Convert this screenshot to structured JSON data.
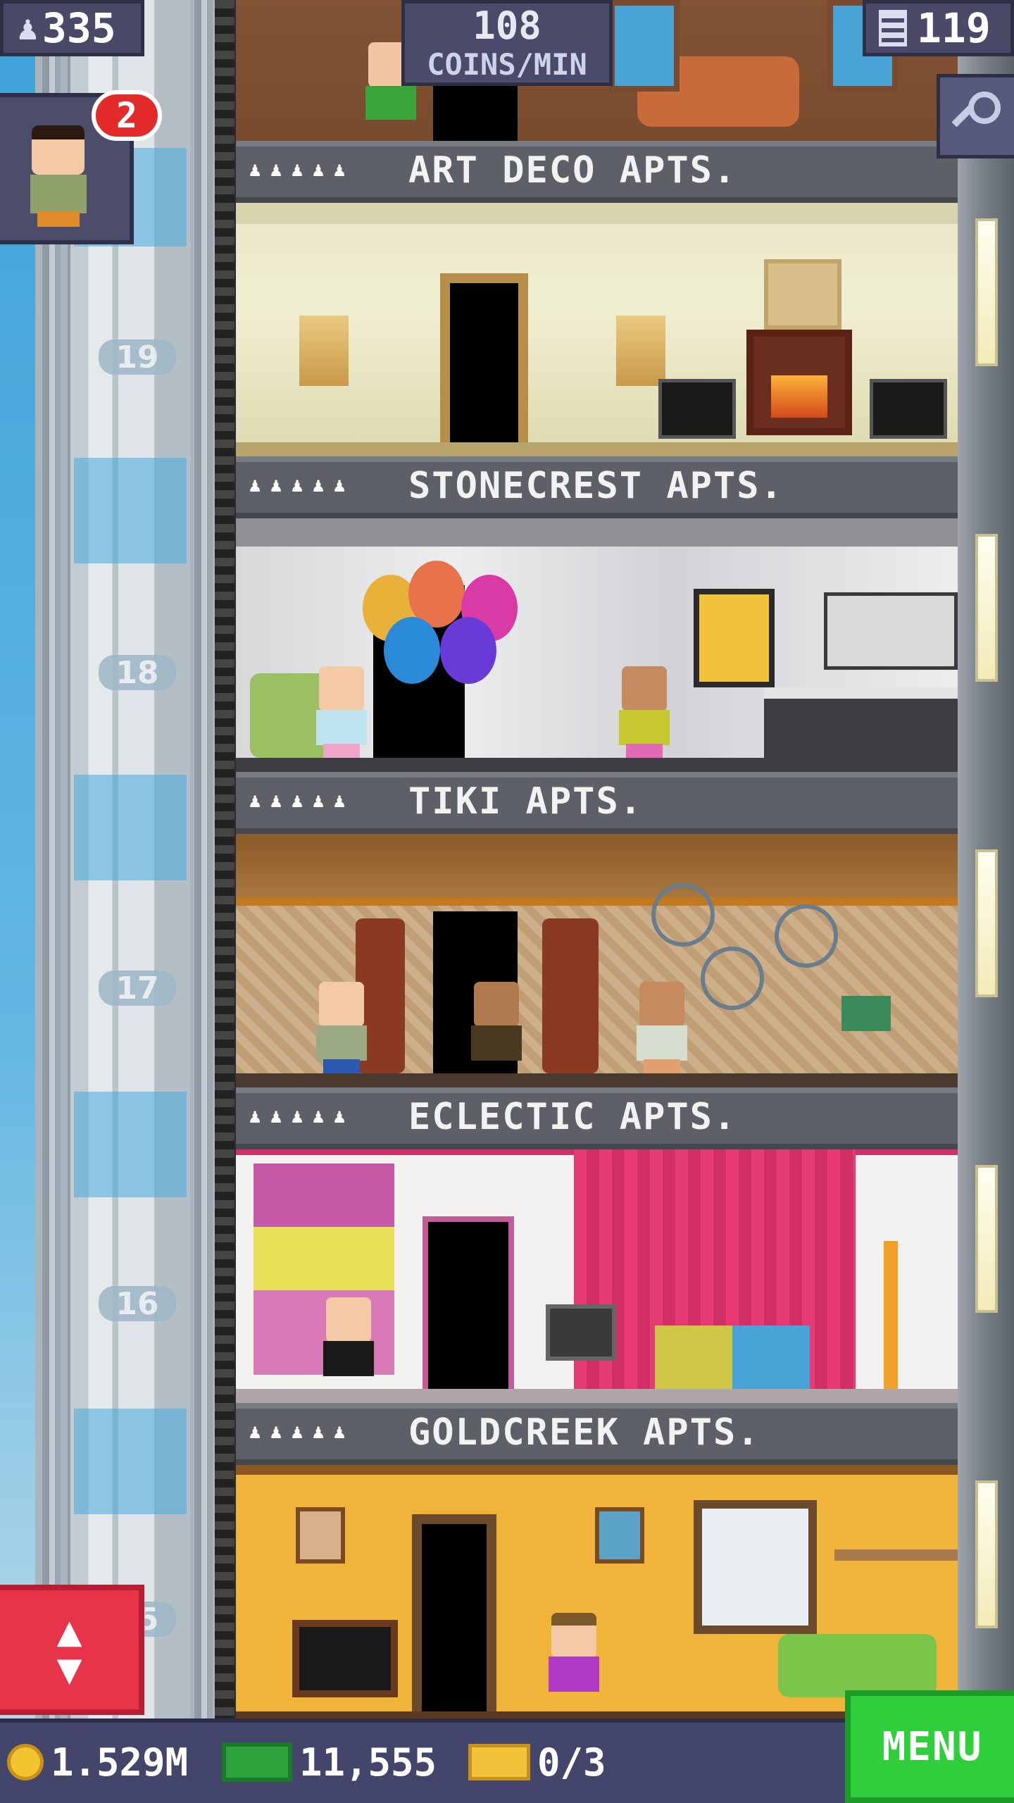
{
  "hud": {
    "population": "335",
    "coins_rate_value": "108",
    "coins_rate_unit": "COINS/MIN",
    "floor_count": "119",
    "visitor_badge": "2"
  },
  "shaft": {
    "markers": [
      "19",
      "18",
      "17",
      "16",
      "15"
    ]
  },
  "floors": [
    {
      "name": "ART DECO APTS.",
      "resident_slots": [
        "♟",
        "♟",
        "♟",
        "♟",
        "♟"
      ]
    },
    {
      "name": "STONECREST APTS.",
      "resident_slots": [
        "♟",
        "♟",
        "♟",
        "♟",
        "♟"
      ]
    },
    {
      "name": "TIKI APTS.",
      "resident_slots": [
        "♟",
        "♟",
        "♟",
        "♟",
        "♟"
      ]
    },
    {
      "name": "ECLECTIC APTS.",
      "resident_slots": [
        "♟",
        "♟",
        "♟",
        "♟",
        "♟"
      ]
    },
    {
      "name": "GOLDCREEK APTS.",
      "resident_slots": [
        "♟",
        "♟",
        "♟",
        "♟",
        "♟"
      ]
    }
  ],
  "bottom": {
    "coins": "1.529M",
    "bux": "11,555",
    "tickets": "0/3",
    "menu": "MENU"
  },
  "icons": {
    "population": "person-icon",
    "floors": "building-icon",
    "search": "magnifier-icon",
    "coin": "coin-icon",
    "bux": "cash-icon",
    "ticket": "ticket-icon",
    "elevator": "up-down-arrows-icon"
  },
  "colors": {
    "hud_bg": "#4a4a68",
    "menu_green": "#2ecf3a",
    "elevator_red": "#e8344a",
    "badge_red": "#e32b2b"
  }
}
